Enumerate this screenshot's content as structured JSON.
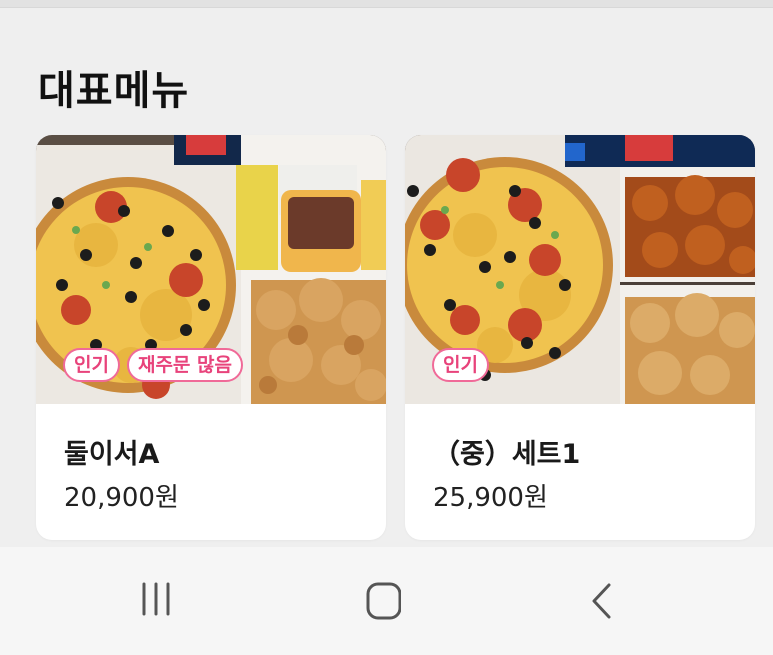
{
  "section": {
    "title": "대표메뉴"
  },
  "menu": [
    {
      "name": "둘이서A",
      "price": "20,900원",
      "badges": [
        "인기",
        "재주문 많음"
      ],
      "image": "pizza-chicken-set-photo"
    },
    {
      "name": "（중）세트1",
      "price": "25,900원",
      "badges": [
        "인기"
      ],
      "image": "pizza-two-chicken-set-photo"
    }
  ],
  "navbar": {
    "recents": "recent-apps-icon",
    "home": "home-icon",
    "back": "back-icon"
  },
  "colors": {
    "badge_border": "#f06a98",
    "badge_text": "#e8437b",
    "background": "#efefef"
  }
}
